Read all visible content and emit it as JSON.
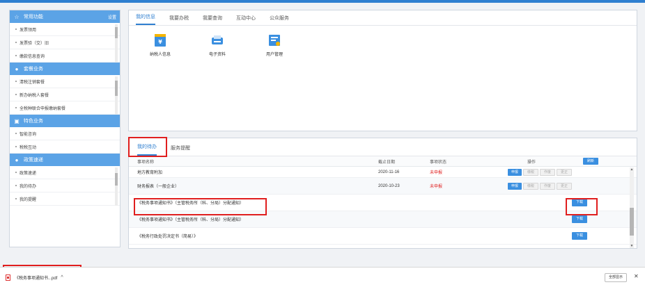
{
  "sidebar": {
    "sections": [
      {
        "title": "常用功能",
        "extra": "设置",
        "icon": "star-icon",
        "items": [
          "发票领用",
          "发票验（交）旧",
          "缴款信息查询"
        ]
      },
      {
        "title": "套餐业务",
        "icon": "disc-icon",
        "items": [
          "清税注销套餐",
          "新办纳税人套餐",
          "全税种联合申报缴纳套餐"
        ]
      },
      {
        "title": "特色业务",
        "icon": "grid-icon",
        "items": [
          "智能咨询",
          "税税互动"
        ]
      },
      {
        "title": "政策速递",
        "icon": "disc-icon",
        "items": [
          "政策速递",
          "我的待办",
          "我的提醒"
        ]
      }
    ]
  },
  "upper": {
    "tabs": [
      "我的信息",
      "我要办税",
      "我要查询",
      "互动中心",
      "公众服务"
    ],
    "active_tab": 0,
    "quick": [
      {
        "label": "纳税人信息",
        "icon": "taxpayer-info-icon"
      },
      {
        "label": "电子资料",
        "icon": "electronic-data-icon"
      },
      {
        "label": "用户管理",
        "icon": "user-management-icon"
      }
    ]
  },
  "lower": {
    "tabs": [
      "我的待办",
      "服务提醒"
    ],
    "active_tab": 0,
    "headers": {
      "name": "事项名称",
      "date": "截止日期",
      "status": "事项状态",
      "ops": "操作",
      "refresh": "刷新"
    },
    "op_buttons": [
      "申报",
      "缴税",
      "作废",
      "更正"
    ],
    "download_label": "下载",
    "rows": [
      {
        "name": "地方教育附加",
        "date": "2020-11-16",
        "status": "未申报",
        "type": "ops"
      },
      {
        "name": "财务报表（一般企业）",
        "date": "2020-10-23",
        "status": "未申报",
        "type": "ops"
      },
      {
        "name": "《税务事项通知书》（主管税务所（科、分局）分配通知）",
        "date": "",
        "status": "",
        "type": "download"
      },
      {
        "name": "《税务事项通知书》（主管税务所（科、分局）分配通知）",
        "date": "",
        "status": "",
        "type": "download"
      },
      {
        "name": "《税务行政处罚决定书（简易）》",
        "date": "",
        "status": "",
        "type": "download"
      }
    ]
  },
  "download_bar": {
    "file_name": "《税务事项通知书...pdf",
    "show_all": "全部显示"
  },
  "colors": {
    "accent": "#2f7fd0",
    "sidebar_header": "#5ba3e6",
    "alert": "#e01e1e"
  }
}
